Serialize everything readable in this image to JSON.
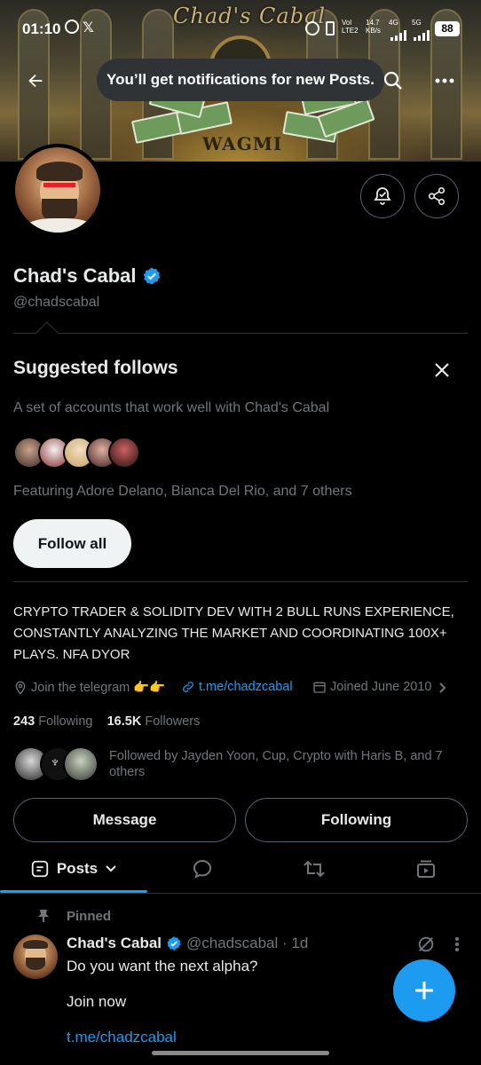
{
  "status_bar": {
    "time": "01:10",
    "network_1": "Vol LTE2",
    "speed": "14.7 KB/s",
    "net_4g": "4G",
    "net_5g": "5G",
    "battery": "88"
  },
  "banner": {
    "title": "Chad's Cabal",
    "sub": "WAGMI"
  },
  "toast": {
    "text": "You’ll get notifications for new Posts."
  },
  "profile": {
    "display_name": "Chad's Cabal",
    "handle": "@chadscabal",
    "bio": "CRYPTO TRADER & SOLIDITY DEV WITH 2 BULL RUNS EXPERIENCE, CONSTANTLY ANALYZING THE MARKET AND COORDINATING 100X+ PLAYS. NFA DYOR",
    "location": "Join the telegram 👉👉",
    "website": "t.me/chadzcabal",
    "joined": "Joined June 2010",
    "following_count": "243",
    "following_label": "Following",
    "followers_count": "16.5K",
    "followers_label": "Followers",
    "followed_by": "Followed by Jayden Yoon, Cup, Crypto with Haris B, and 7 others"
  },
  "suggested": {
    "title": "Suggested follows",
    "description": "A set of accounts that work well with Chad's Cabal",
    "featuring": "Featuring Adore Delano, Bianca Del Rio, and 7 others",
    "follow_all_label": "Follow all"
  },
  "actions": {
    "message_label": "Message",
    "following_label": "Following"
  },
  "tabs": {
    "posts_label": "Posts"
  },
  "post": {
    "pinned_label": "Pinned",
    "author": "Chad's Cabal",
    "handle_time": "@chadscabal · 1d",
    "line1": "Do you want the next alpha?",
    "line2": "Join now",
    "link": "t.me/chadzcabal"
  },
  "colors": {
    "accent": "#1d9bf0",
    "muted": "#71767b",
    "text": "#e7e9ea",
    "background": "#000000"
  }
}
